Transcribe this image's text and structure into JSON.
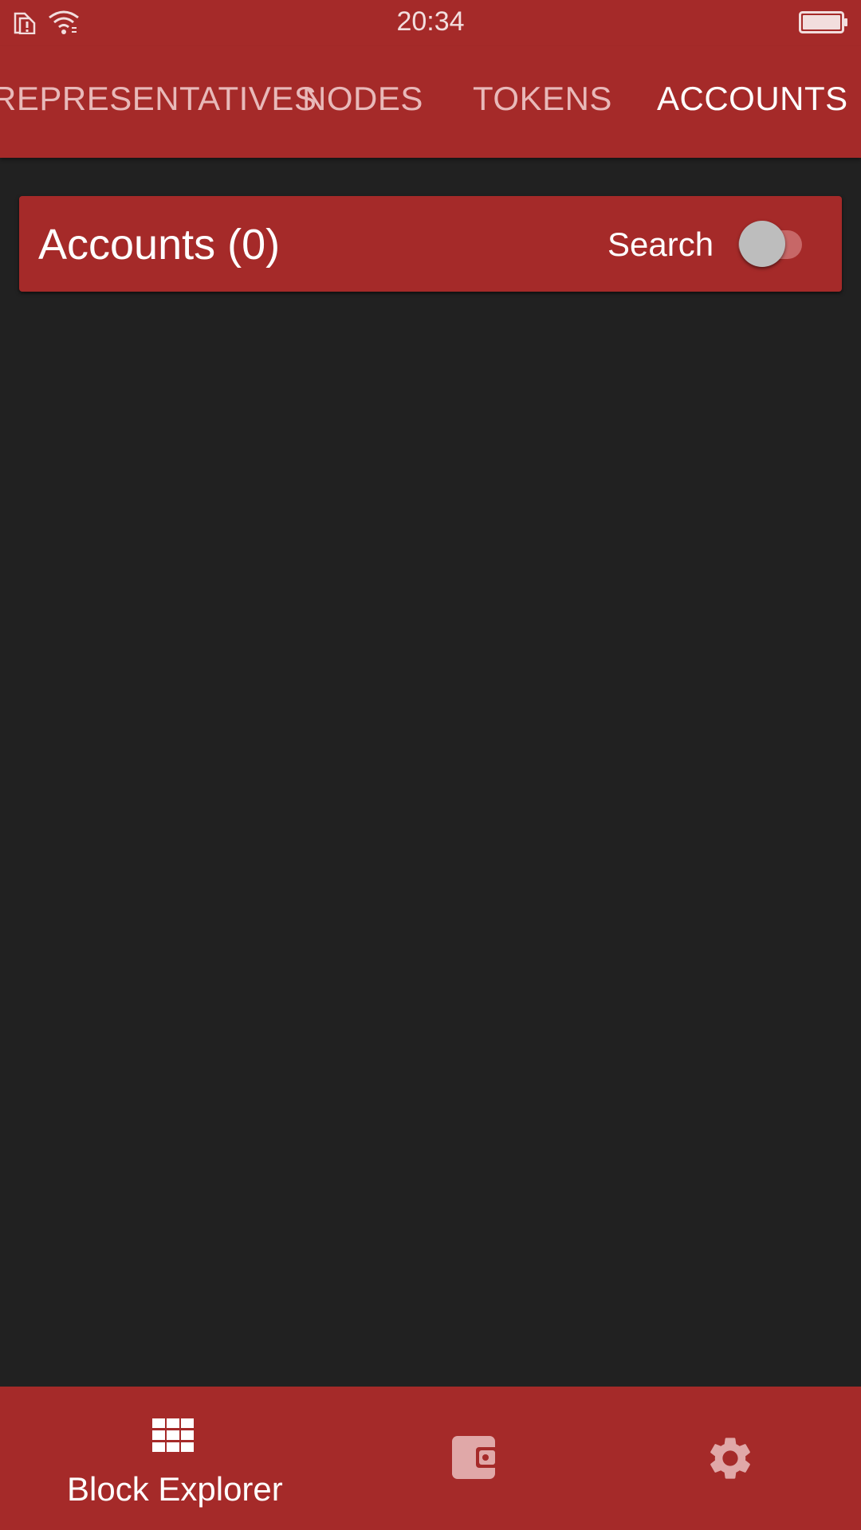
{
  "status_bar": {
    "time": "20:34",
    "icons": [
      "sim-alert-icon",
      "wifi-icon",
      "battery-icon"
    ]
  },
  "tabs": [
    {
      "label": "REPRESENTATIVES",
      "active": false
    },
    {
      "label": "NODES",
      "active": false
    },
    {
      "label": "TOKENS",
      "active": false
    },
    {
      "label": "ACCOUNTS",
      "active": true
    }
  ],
  "accounts_card": {
    "title": "Accounts (0)",
    "search_label": "Search",
    "search_toggle_on": false
  },
  "bottom_nav": {
    "items": [
      {
        "label": "Block Explorer",
        "icon": "grid-icon",
        "active": true
      },
      {
        "label": "",
        "icon": "wallet-icon",
        "active": false
      },
      {
        "label": "",
        "icon": "gear-icon",
        "active": false
      }
    ]
  },
  "colors": {
    "primary": "#a52a29",
    "background": "#212121",
    "inactive_tab": "#e8b9b9",
    "toggle_track": "#c76767",
    "toggle_thumb": "#bdbdbd"
  }
}
